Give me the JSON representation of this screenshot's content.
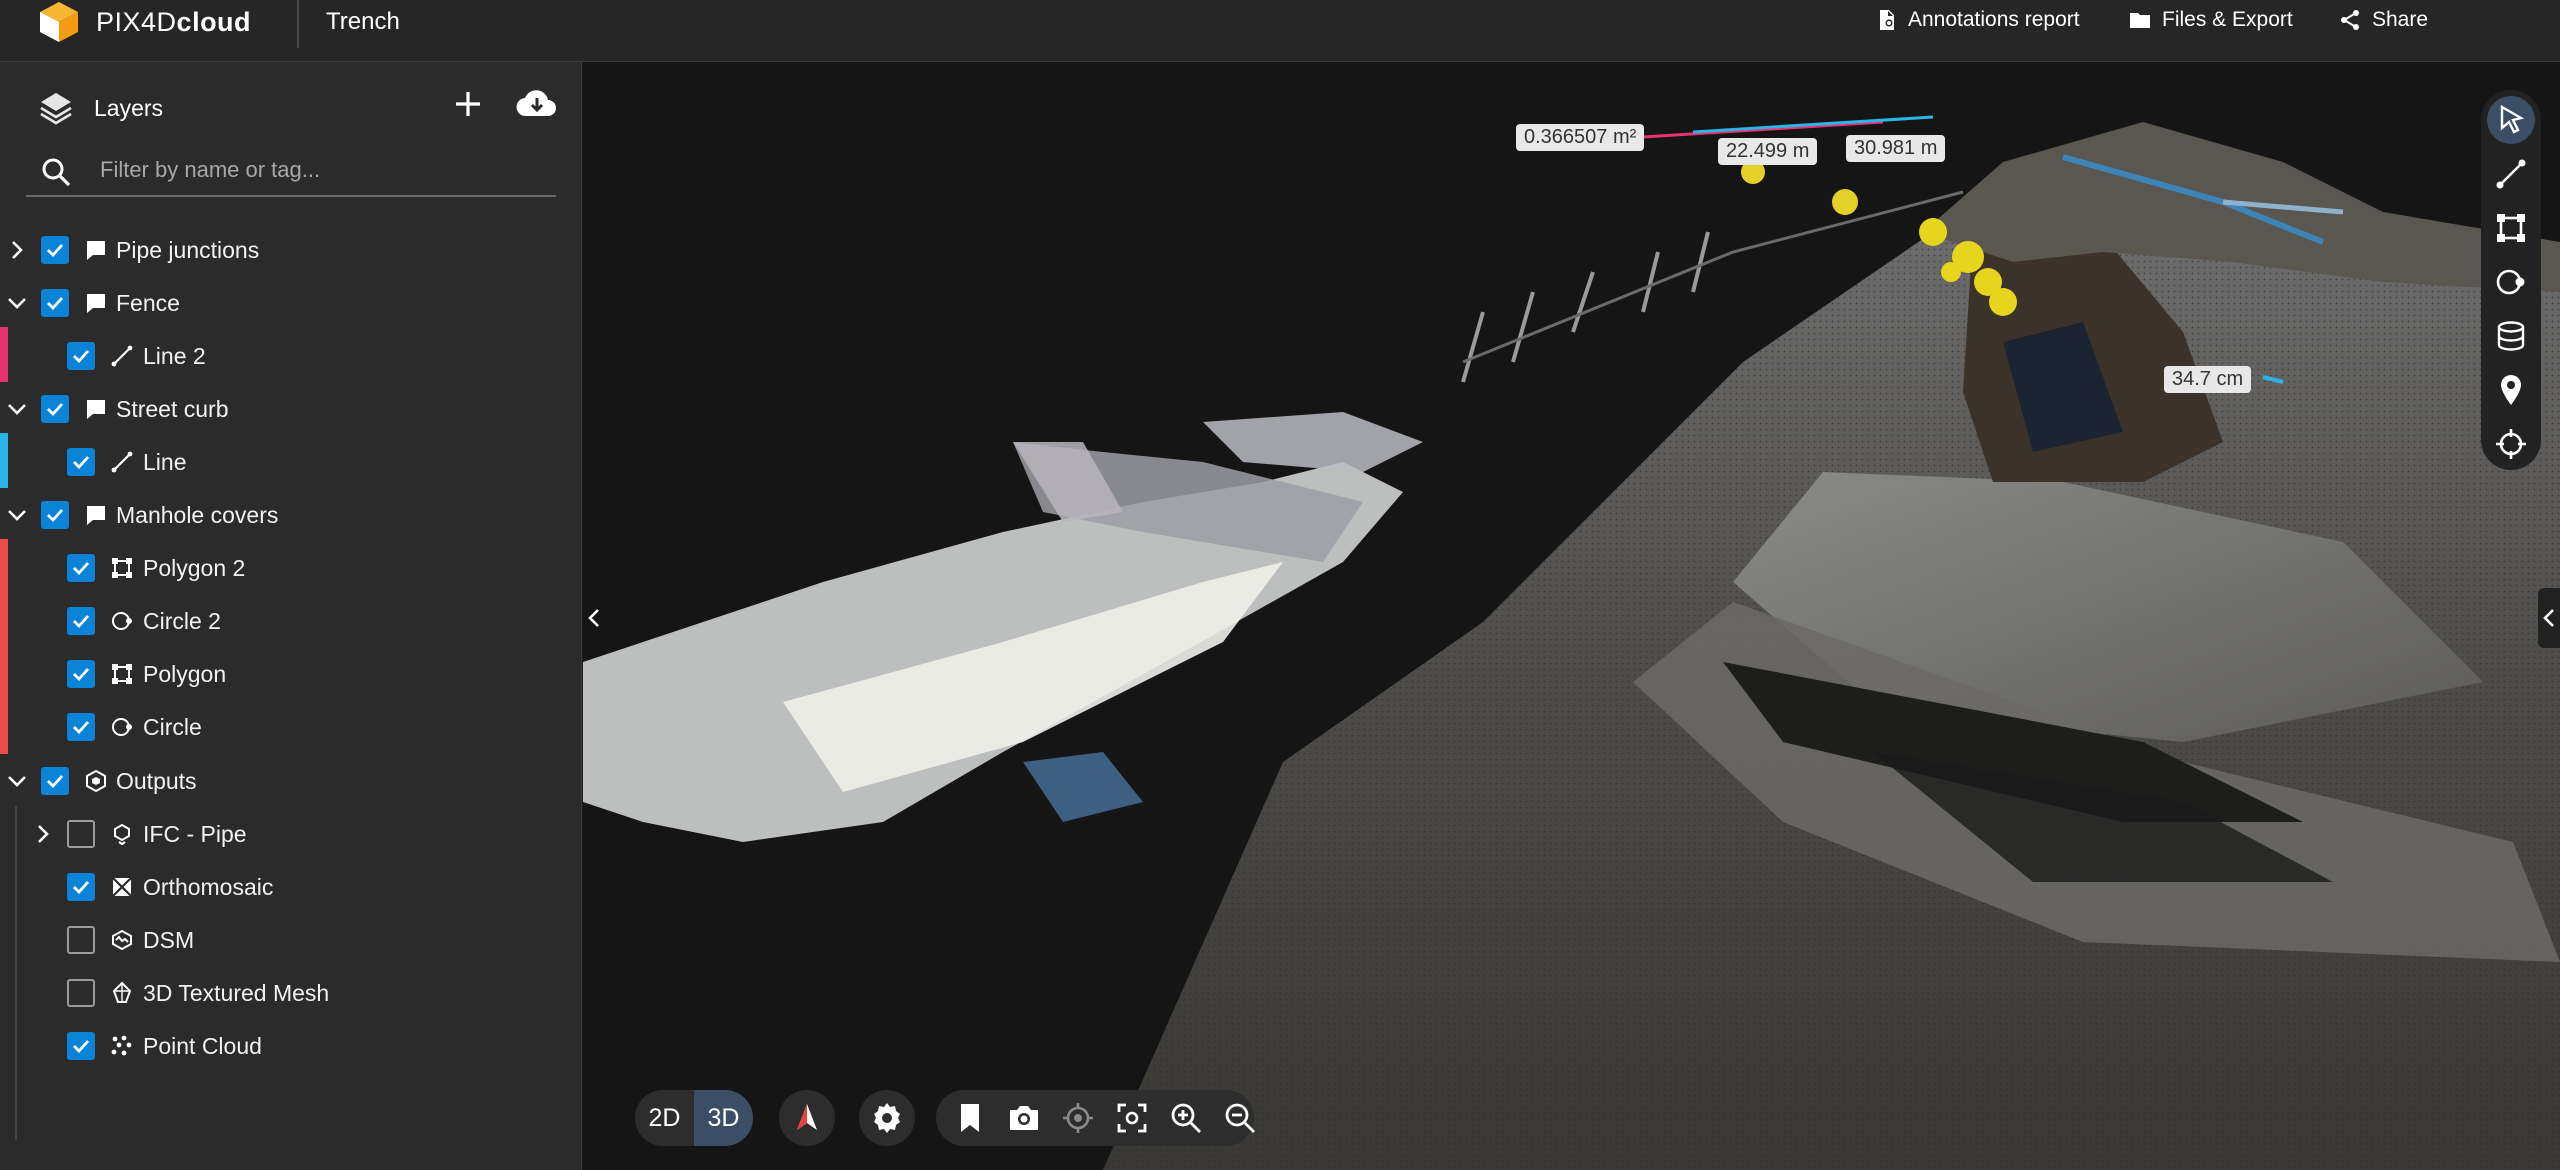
{
  "header": {
    "brand_prefix": "PIX4D",
    "brand_suffix": "cloud",
    "project": "Trench",
    "actions": {
      "annotations_report": "Annotations report",
      "files_export": "Files & Export",
      "share": "Share"
    }
  },
  "sidebar": {
    "title": "Layers",
    "search_placeholder": "Filter by name or tag...",
    "tree": {
      "pipe_junctions": "Pipe junctions",
      "fence": "Fence",
      "line2": "Line 2",
      "street_curb": "Street curb",
      "line": "Line",
      "manhole_covers": "Manhole covers",
      "polygon2": "Polygon 2",
      "circle2": "Circle 2",
      "polygon": "Polygon",
      "circle": "Circle",
      "outputs": "Outputs",
      "ifc_pipe": "IFC - Pipe",
      "orthomosaic": "Orthomosaic",
      "dsm": "DSM",
      "textured_mesh": "3D Textured Mesh",
      "point_cloud": "Point Cloud"
    },
    "colors": {
      "fence": "#e8336e",
      "street_curb": "#2ab4e8",
      "manhole_covers": "#ee4a4a",
      "checkbox": "#0b84d8"
    }
  },
  "viewport": {
    "measurements": {
      "area": "0.366507 m²",
      "length1": "22.499 m",
      "length2": "30.981 m",
      "height": "34.7 cm"
    },
    "view_modes": {
      "mode_2d": "2D",
      "mode_3d": "3D",
      "active": "3D"
    }
  }
}
